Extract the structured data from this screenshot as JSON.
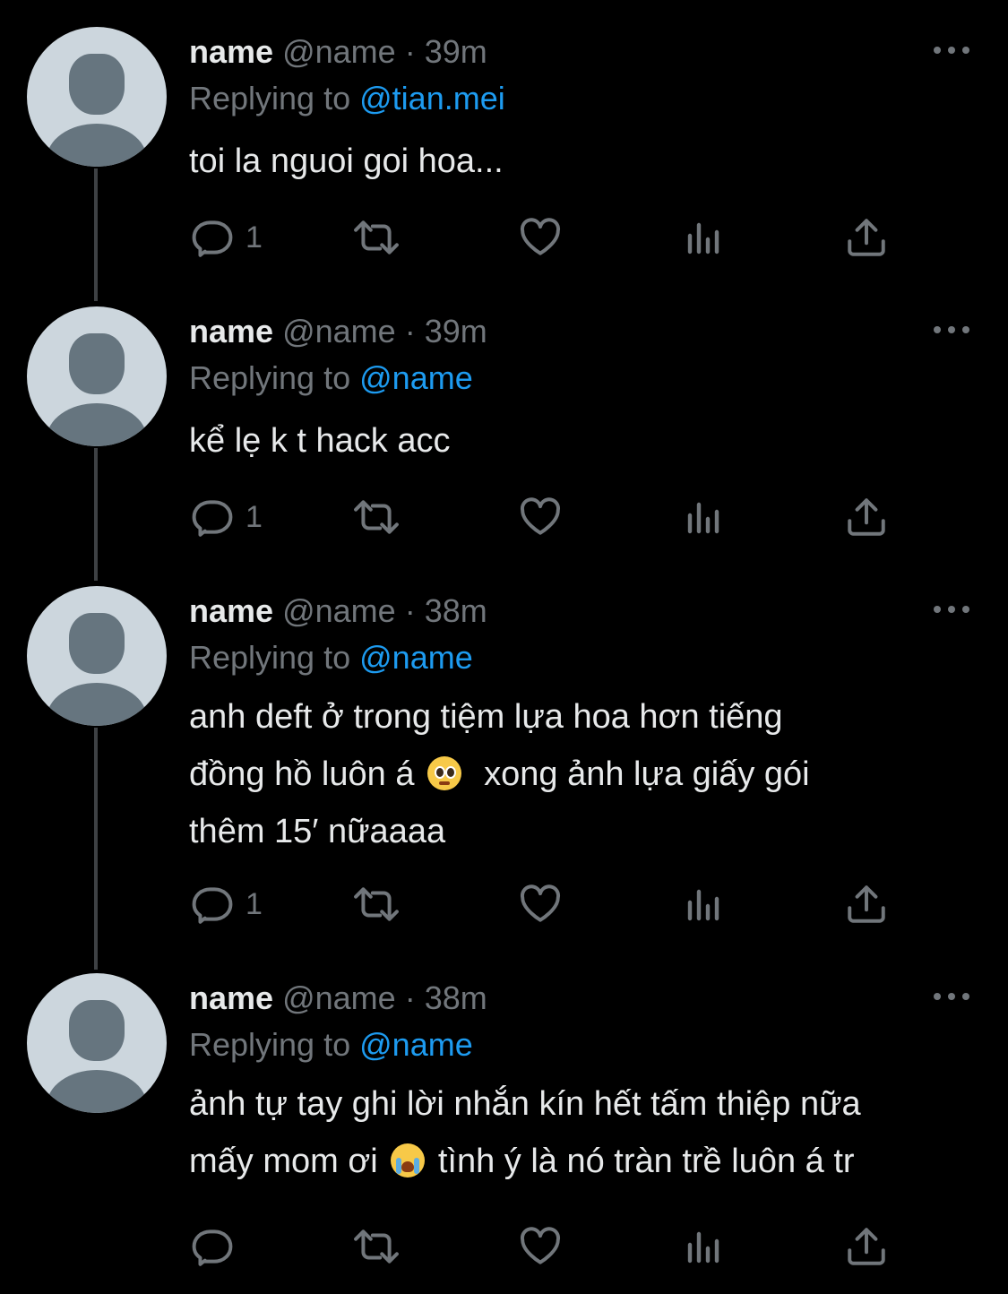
{
  "thread": [
    {
      "name": "name",
      "handle": "@name",
      "separator": "·",
      "time": "39m",
      "replying_label": "Replying to",
      "replying_to": "@tian.mei",
      "text_lines": [
        "toi la nguoi goi hoa..."
      ],
      "reply_count": "1"
    },
    {
      "name": "name",
      "handle": "@name",
      "separator": "·",
      "time": "39m",
      "replying_label": "Replying to",
      "replying_to": "@name",
      "text_lines": [
        "kể lẹ k t hack acc"
      ],
      "reply_count": "1"
    },
    {
      "name": "name",
      "handle": "@name",
      "separator": "·",
      "time": "38m",
      "replying_label": "Replying to",
      "replying_to": "@name",
      "text_lines": [
        "anh deft ở trong tiệm lựa hoa hơn tiếng",
        "đồng hồ luôn á",
        "xong ảnh lựa giấy gói",
        "thêm 15′ nữaaaa"
      ],
      "reply_count": "1"
    },
    {
      "name": "name",
      "handle": "@name",
      "separator": "·",
      "time": "38m",
      "replying_label": "Replying to",
      "replying_to": "@name",
      "text_lines": [
        "ảnh tự tay ghi lời nhắn kín hết tấm thiệp nữa",
        "mấy mom ơi",
        "tình ý là nó tràn trề luôn á tr"
      ],
      "reply_count": ""
    }
  ],
  "icons": {
    "reply": "reply-icon",
    "retweet": "retweet-icon",
    "like": "heart-icon",
    "views": "analytics-icon",
    "share": "share-icon",
    "more": "more-options-icon",
    "pleading_emoji": "pleading-face-emoji",
    "crying_emoji": "loudly-crying-face-emoji"
  },
  "colors": {
    "background": "#000000",
    "text": "#e7e9ea",
    "secondary": "#71767b",
    "link": "#1d9bf0",
    "thread_line": "#3e4144"
  }
}
